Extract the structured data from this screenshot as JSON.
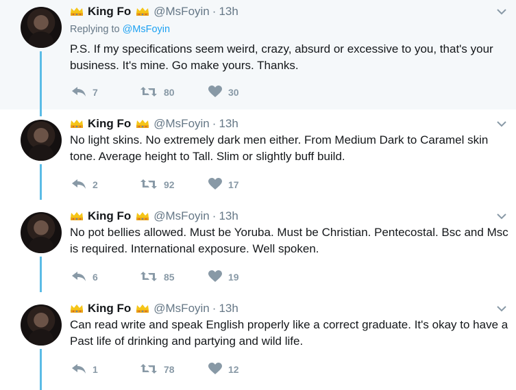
{
  "colors": {
    "accent": "#1da1f2",
    "thread_line": "#5bbce6",
    "muted": "#657786",
    "icon": "#8899a6"
  },
  "replying_to": {
    "prefix": "Replying to",
    "handle": "@MsFoyin"
  },
  "tweets": [
    {
      "name": "King Fo",
      "handle": "@MsFoyin",
      "separator": "·",
      "time": "13h",
      "text": "P.S. If my specifications seem weird, crazy, absurd or excessive to you, that's your business. It's mine. Go make yours. Thanks.",
      "replies": "7",
      "retweets": "80",
      "likes": "30"
    },
    {
      "name": "King Fo",
      "handle": "@MsFoyin",
      "separator": "·",
      "time": "13h",
      "text": "No light skins. No extremely dark men either. From Medium Dark to Caramel skin tone. Average height to Tall. Slim or slightly buff build.",
      "replies": "2",
      "retweets": "92",
      "likes": "17"
    },
    {
      "name": "King Fo",
      "handle": "@MsFoyin",
      "separator": "·",
      "time": "13h",
      "text": "No pot bellies allowed. Must be Yoruba. Must be Christian. Pentecostal. Bsc and Msc is required. International exposure. Well spoken.",
      "replies": "6",
      "retweets": "85",
      "likes": "19"
    },
    {
      "name": "King Fo",
      "handle": "@MsFoyin",
      "separator": "·",
      "time": "13h",
      "text": "Can read write and speak English properly like a correct graduate. It's okay to have a Past life of drinking and partying and wild life.",
      "replies": "1",
      "retweets": "78",
      "likes": "12"
    }
  ],
  "icons": {
    "crown": "crown-emoji",
    "reply": "reply-icon",
    "retweet": "retweet-icon",
    "like": "heart-icon",
    "more": "chevron-down-icon"
  }
}
